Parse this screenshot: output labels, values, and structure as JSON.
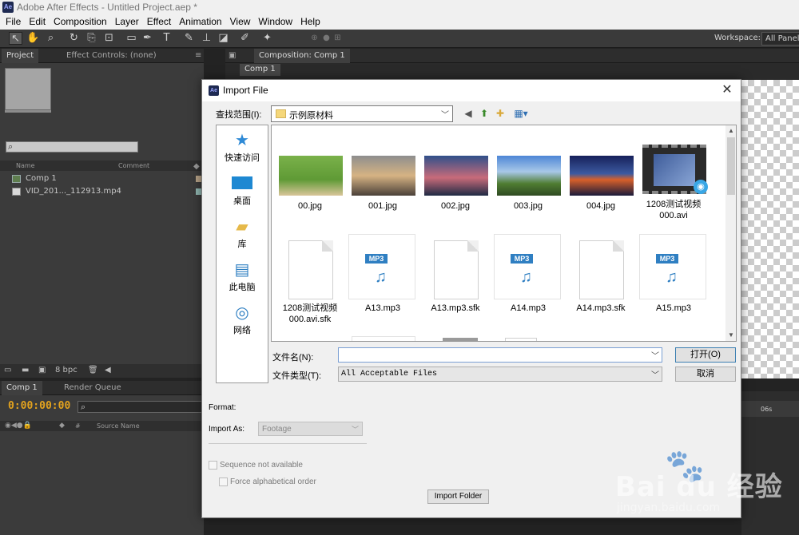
{
  "app": {
    "title": "Adobe After Effects - Untitled Project.aep *",
    "logo": "Ae",
    "menu": [
      "File",
      "Edit",
      "Composition",
      "Layer",
      "Effect",
      "Animation",
      "View",
      "Window",
      "Help"
    ],
    "workspace_label": "Workspace:",
    "workspace_value": "All Panels"
  },
  "project_panel": {
    "tab_project": "Project",
    "tab_effect_controls": "Effect Controls: (none)",
    "columns": {
      "name": "Name",
      "comment": "Comment"
    },
    "items": [
      {
        "name": "Comp 1",
        "icon": "composition-icon",
        "color": "#b6a287"
      },
      {
        "name": "VID_201..._112913.mp4",
        "icon": "video-file-icon",
        "color": "#8fb6b0"
      }
    ],
    "footer_bpc": "8 bpc"
  },
  "composition_panel": {
    "tab": "Composition: Comp 1",
    "subtab": "Comp 1"
  },
  "timeline_panel": {
    "tab_comp": "Comp 1",
    "tab_render_queue": "Render Queue",
    "timecode": "0:00:00:00",
    "column_source_name": "Source Name",
    "column_hash": "#",
    "ruler_label": "06s"
  },
  "dialog": {
    "title": "Import File",
    "look_in_label": "查找范围(I):",
    "look_in_value": "示例原材料",
    "places": [
      {
        "label": "快速访问",
        "icon": "star-icon"
      },
      {
        "label": "桌面",
        "icon": "desktop-icon"
      },
      {
        "label": "库",
        "icon": "library-icon"
      },
      {
        "label": "此电脑",
        "icon": "computer-icon"
      },
      {
        "label": "网络",
        "icon": "network-icon"
      }
    ],
    "files": [
      {
        "name": "00.jpg",
        "kind": "image",
        "colors": [
          "#6aa03c",
          "#e6d9c2"
        ]
      },
      {
        "name": "001.jpg",
        "kind": "image",
        "colors": [
          "#c9a27a",
          "#50473f"
        ]
      },
      {
        "name": "002.jpg",
        "kind": "image",
        "colors": [
          "#3a5a9a",
          "#e27a6a"
        ]
      },
      {
        "name": "003.jpg",
        "kind": "image",
        "colors": [
          "#5a8ad0",
          "#3f6b2c"
        ]
      },
      {
        "name": "004.jpg",
        "kind": "image",
        "colors": [
          "#1e2b6a",
          "#d9642b"
        ]
      },
      {
        "name": "1208测试视频000.avi",
        "kind": "video"
      },
      {
        "name": "1208测试视频000.avi.sfk",
        "kind": "blank"
      },
      {
        "name": "A13.mp3",
        "kind": "mp3"
      },
      {
        "name": "A13.mp3.sfk",
        "kind": "blank"
      },
      {
        "name": "A14.mp3",
        "kind": "mp3"
      },
      {
        "name": "A14.mp3.sfk",
        "kind": "blank"
      },
      {
        "name": "A15.mp3",
        "kind": "mp3"
      }
    ],
    "mp3_tag": "MP3",
    "file_name_label": "文件名(N):",
    "file_name_value": "",
    "file_type_label": "文件类型(T):",
    "file_type_value": "All Acceptable Files",
    "open_button": "打开(O)",
    "cancel_button": "取消",
    "format_label": "Format:",
    "import_as_label": "Import As:",
    "import_as_value": "Footage",
    "sequence_label": "Sequence not available",
    "force_alpha_label": "Force alphabetical order",
    "import_folder_button": "Import Folder"
  },
  "watermark": {
    "brand": "Bai du 经验",
    "url": "jingyan.baidu.com"
  }
}
